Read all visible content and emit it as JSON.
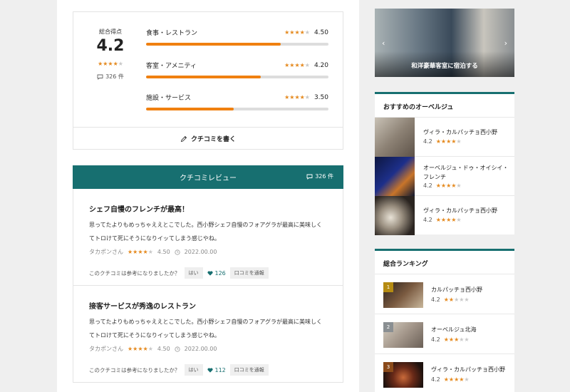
{
  "overall": {
    "label": "総合得点",
    "score": "4.2",
    "stars": 4,
    "review_count": "326 件"
  },
  "categories": [
    {
      "name": "食事・レストラン",
      "value": "4.50",
      "stars": 4,
      "fill": 0.74
    },
    {
      "name": "客室・アメニティ",
      "value": "4.20",
      "stars": 4,
      "fill": 0.63
    },
    {
      "name": "施設・サービス",
      "value": "3.50",
      "stars": 4,
      "fill": 0.48
    }
  ],
  "write_review_label": "クチコミを書く",
  "review_section": {
    "title": "クチコミレビュー",
    "count": "326 件"
  },
  "reviews": [
    {
      "title": "シェフ自慢のフレンチが最高！",
      "body": "思ってたよりもめっちゃええとこでした。西小野シェフ自慢のフォアグラが最高に美味しくてトロけて死にそうになりイッてしまう感じやね。",
      "author": "タカポンさん",
      "stars": 4,
      "score": "4.50",
      "date": "2022.00.00",
      "helpful_q": "このクチコミは参考になりましたか？",
      "yes_label": "はい",
      "likes": "126",
      "report_label": "口コミを通報"
    },
    {
      "title": "接客サービスが秀逸のレストラン",
      "body": "思ってたよりもめっちゃええとこでした。西小野シェフ自慢のフォアグラが最高に美味しくてトロけて死にそうになりイッてしまう感じやね。",
      "author": "タカポンさん",
      "stars": 4,
      "score": "4.50",
      "date": "2022.00.00",
      "helpful_q": "このクチコミは参考になりましたか？",
      "yes_label": "はい",
      "likes": "112",
      "report_label": "口コミを通報"
    }
  ],
  "hero": {
    "caption": "和洋豪華客室に宿泊する"
  },
  "recommended": {
    "title": "おすすめのオーベルジュ",
    "items": [
      {
        "name": "ヴィラ・カルパッチョ西小野",
        "score": "4.2",
        "stars": 4
      },
      {
        "name": "オーベルジュ・ドゥ・オイシイ・フレンチ",
        "score": "4.2",
        "stars": 4
      },
      {
        "name": "ヴィラ・カルパッチョ西小野",
        "score": "4.2",
        "stars": 4
      }
    ]
  },
  "ranking": {
    "title": "総合ランキング",
    "items": [
      {
        "rank": "1",
        "name": "カルパッチョ西小野",
        "score": "4.2",
        "stars": 2
      },
      {
        "rank": "2",
        "name": "オーベルジュ北海",
        "score": "4.2",
        "stars": 3
      },
      {
        "rank": "3",
        "name": "ヴィラ・カルパッチョ西小野",
        "score": "4.2",
        "stars": 4
      }
    ]
  },
  "colors": {
    "accent": "#176f70",
    "bar_fill": "#f08010",
    "star_on": "#e58a1f",
    "rank_gold": "#b58b12",
    "rank_silver": "#8a8f92",
    "rank_bronze": "#8a4a1a"
  }
}
